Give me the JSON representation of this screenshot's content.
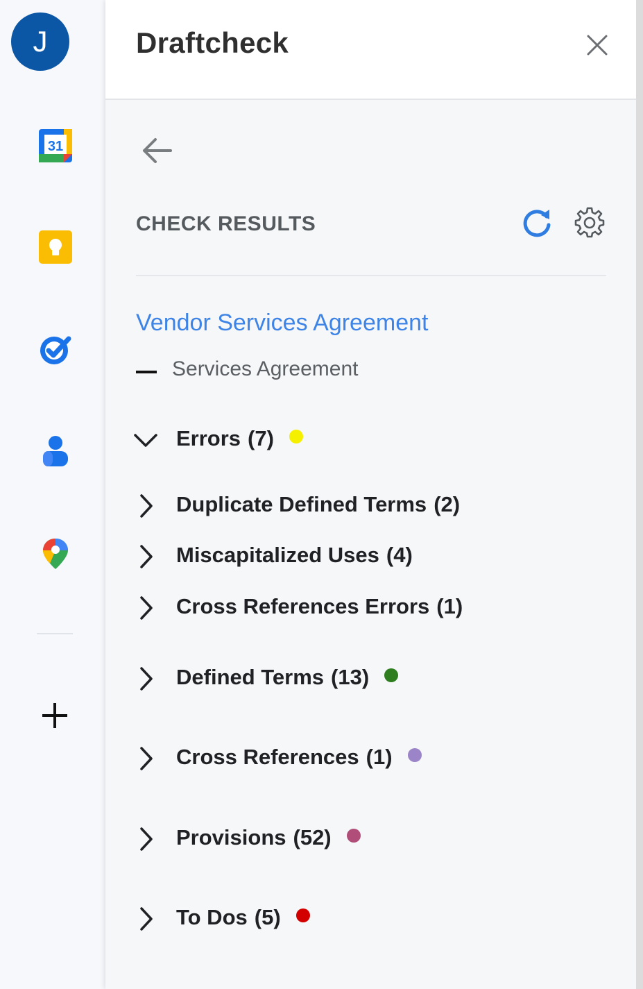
{
  "rail": {
    "avatar_letter": "J",
    "apps": [
      {
        "name": "calendar-icon",
        "text": "31"
      },
      {
        "name": "keep-icon"
      },
      {
        "name": "tasks-icon"
      },
      {
        "name": "contacts-icon"
      },
      {
        "name": "maps-icon"
      }
    ],
    "add_icon": "plus-icon"
  },
  "panel": {
    "title": "Draftcheck",
    "section_title": "CHECK RESULTS",
    "document_title": "Vendor Services Agreement",
    "document_subtitle": "Services Agreement"
  },
  "categories": [
    {
      "label": "Errors",
      "count": "(7)",
      "expanded": true,
      "dot_color": "#f5f000"
    },
    {
      "label": "Duplicate Defined Terms",
      "count": "(2)",
      "sub": true
    },
    {
      "label": "Miscapitalized Uses",
      "count": "(4)",
      "sub": true
    },
    {
      "label": "Cross References Errors",
      "count": "(1)",
      "sub": true
    },
    {
      "label": "Defined Terms",
      "count": "(13)",
      "dot_color": "#2e7d1f"
    },
    {
      "label": "Cross References",
      "count": "(1)",
      "dot_color": "#9b84c7"
    },
    {
      "label": "Provisions",
      "count": "(52)",
      "dot_color": "#b04d78"
    },
    {
      "label": "To Dos",
      "count": "(5)",
      "dot_color": "#d30000"
    }
  ],
  "colors": {
    "accent_blue": "#3d84e6",
    "avatar": "#0b57a6"
  }
}
